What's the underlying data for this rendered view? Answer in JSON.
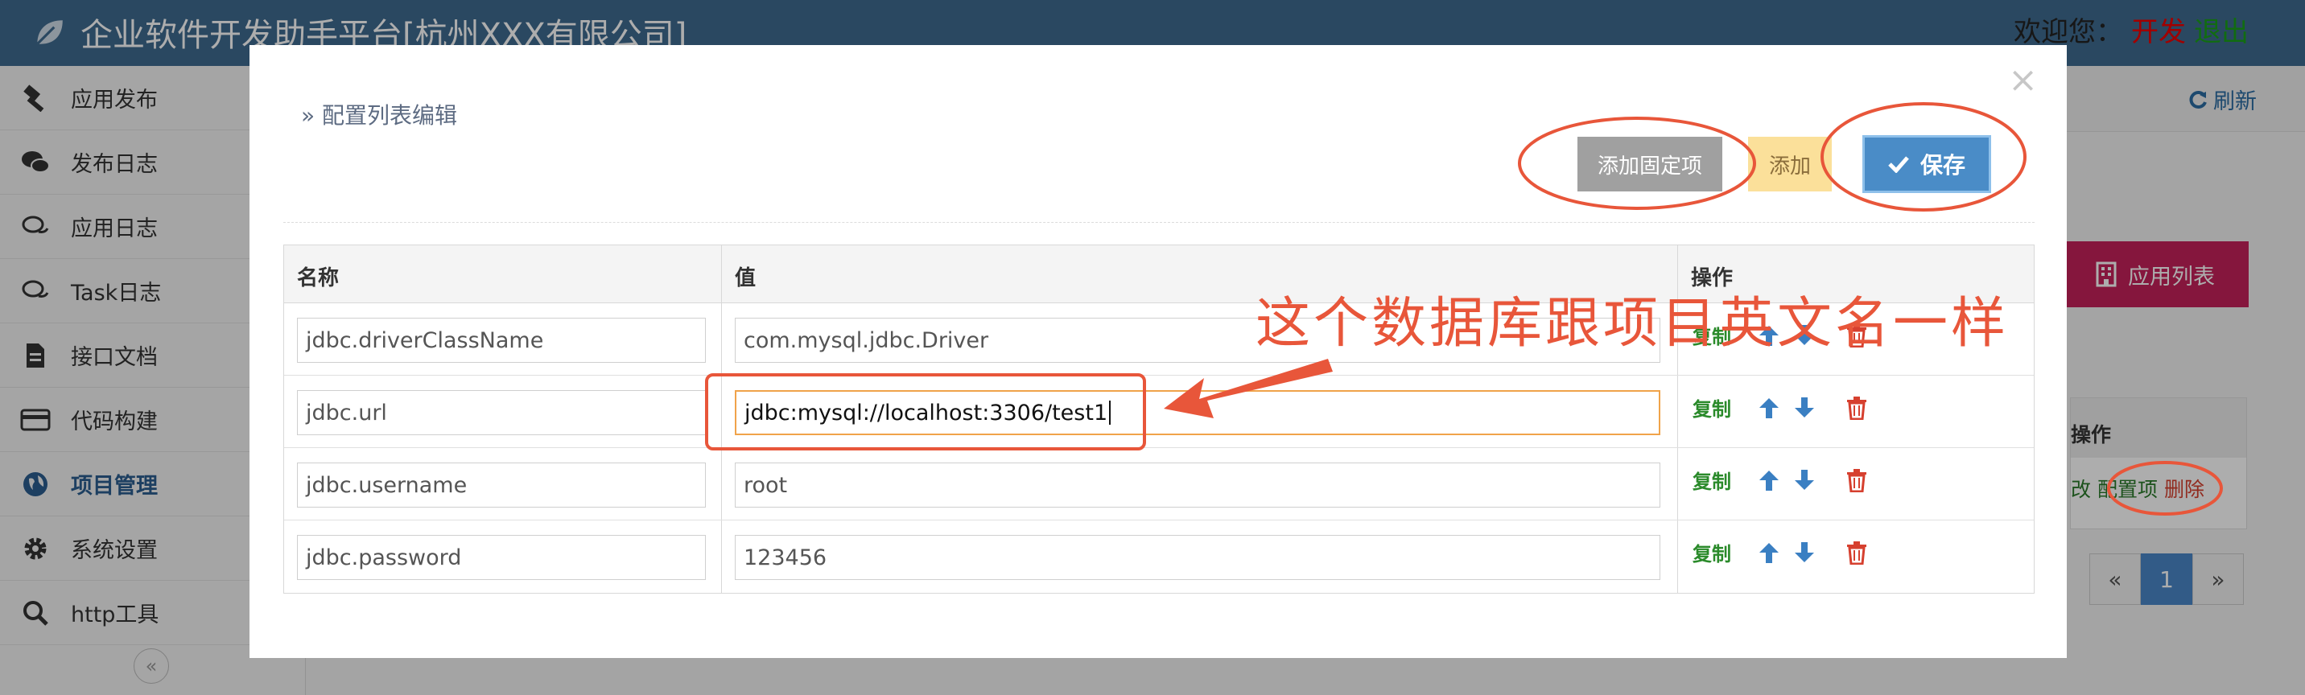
{
  "header": {
    "app_title": "企业软件开发助手平台[杭州XXX有限公司]",
    "welcome": "欢迎您：",
    "user_name": "开发",
    "logout": "退出"
  },
  "sidebar": {
    "items": [
      {
        "label": "应用发布",
        "icon": "hammer-icon"
      },
      {
        "label": "发布日志",
        "icon": "chat-bubbles-icon"
      },
      {
        "label": "应用日志",
        "icon": "chat-outline-icon"
      },
      {
        "label": "Task日志",
        "icon": "chat-outline-icon"
      },
      {
        "label": "接口文档",
        "icon": "document-icon"
      },
      {
        "label": "代码构建",
        "icon": "credit-card-icon"
      },
      {
        "label": "项目管理",
        "icon": "globe-icon",
        "active": true
      },
      {
        "label": "系统设置",
        "icon": "gear-icon"
      },
      {
        "label": "http工具",
        "icon": "search-icon"
      }
    ],
    "collapse_glyph": "«"
  },
  "background": {
    "refresh_label": "刷新",
    "applist_label": "应用列表",
    "table_header": "操作",
    "row_links": {
      "edit": "改",
      "config": "配置项",
      "delete": "删除"
    },
    "pagination": {
      "prev": "«",
      "current": "1",
      "next": "»"
    }
  },
  "modal": {
    "close_glyph": "×",
    "title": "» 配置列表编辑",
    "buttons": {
      "add_fixed": "添加固定项",
      "add": "添加",
      "save": "保存"
    },
    "table": {
      "headers": {
        "name": "名称",
        "value": "值",
        "ops": "操作"
      },
      "op_copy": "复制",
      "rows": [
        {
          "name": "jdbc.driverClassName",
          "value": "com.mysql.jdbc.Driver",
          "focused": false
        },
        {
          "name": "jdbc.url",
          "value": "jdbc:mysql://localhost:3306/test1",
          "focused": true
        },
        {
          "name": "jdbc.username",
          "value": "root",
          "focused": false
        },
        {
          "name": "jdbc.password",
          "value": "123456",
          "focused": false
        }
      ]
    }
  },
  "annotation": {
    "note": "这个数据库跟项目英文名一样",
    "color": "#e8563a"
  }
}
